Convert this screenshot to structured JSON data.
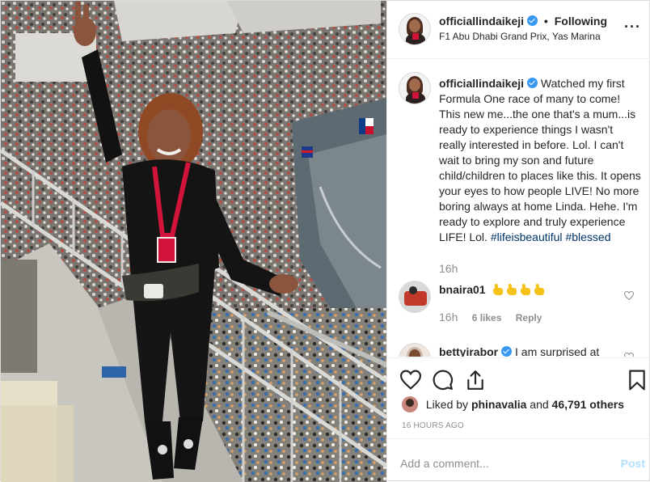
{
  "header": {
    "username": "officiallindaikeji",
    "separator": "•",
    "follow_status": "Following",
    "location": "F1 Abu Dhabi Grand Prix, Yas Marina",
    "more_icon": "more-horizontal-icon",
    "more_label": "..."
  },
  "caption": {
    "username": "officiallindaikeji",
    "text": "Watched my first Formula One race of many to come! This new me...the one that's a mum...is ready to experience things I wasn't really interested in before. Lol. I can't wait to bring my son and future child/children to places like this. It opens your eyes to how people LIVE! No more boring always at home Linda. Hehe. I'm ready to explore and truly experience LIFE! Lol.",
    "hashtags": [
      "#lifeisbeautiful",
      "#blessed"
    ],
    "time": "16h"
  },
  "comments": [
    {
      "username": "bnaira01",
      "emoji_count": 4,
      "emoji_name": "thumbs-up",
      "time": "16h",
      "likes": "6 likes",
      "reply_label": "Reply"
    },
    {
      "username": "bettyirabor",
      "text": "I am surprised at"
    }
  ],
  "actions": {
    "like_icon": "heart-icon",
    "comment_icon": "comment-icon",
    "share_icon": "share-icon",
    "save_icon": "bookmark-icon"
  },
  "likes": {
    "prefix": "Liked by",
    "user": "phinavalia",
    "connector": "and",
    "others": "46,791 others"
  },
  "timestamp": "16 HOURS AGO",
  "add_comment": {
    "placeholder": "Add a comment...",
    "post_label": "Post"
  },
  "colors": {
    "link": "#003569",
    "verified": "#3897f0",
    "muted": "#8e8e8e",
    "post_disabled": "#b2dffc",
    "lanyard": "#d2143a"
  }
}
